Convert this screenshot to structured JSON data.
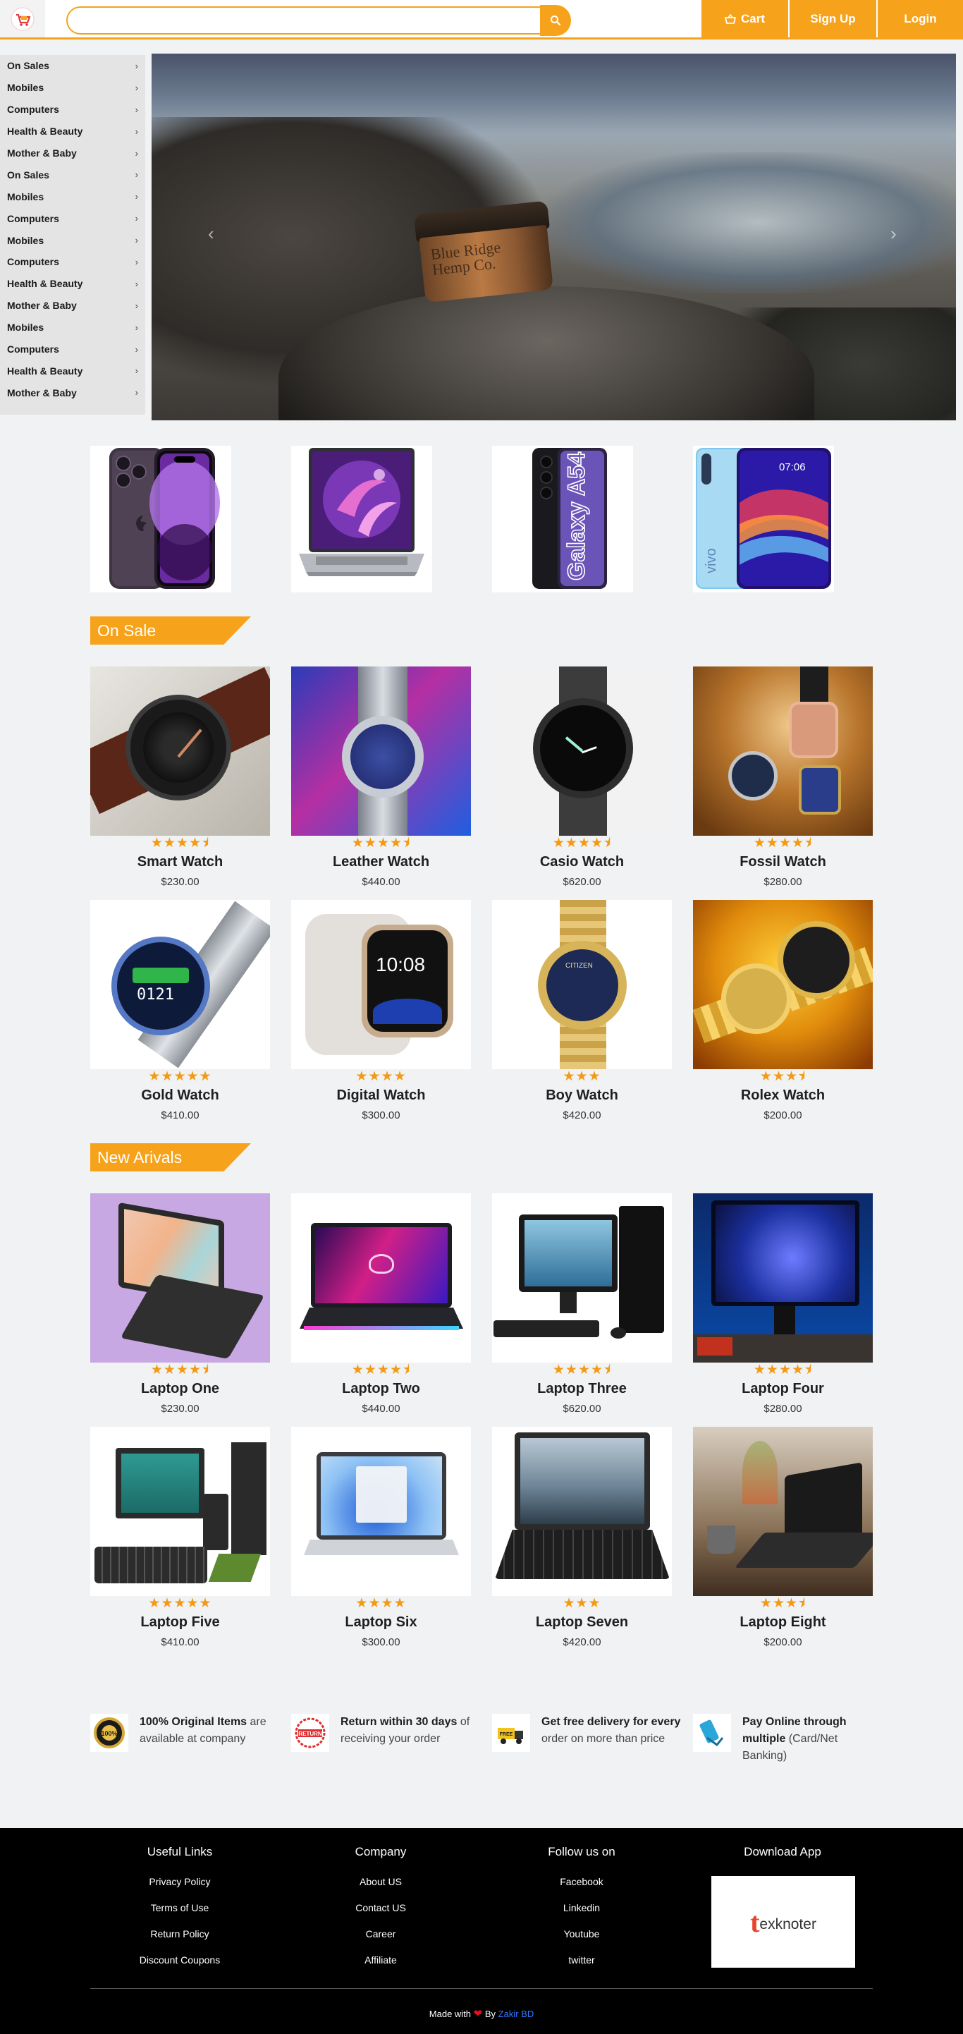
{
  "header": {
    "search": {
      "value": "",
      "placeholder": ""
    },
    "search_icon": "search-icon",
    "nav": {
      "cart": "Cart",
      "signup": "Sign Up",
      "login": "Login"
    },
    "accent_color": "#f7a21b"
  },
  "sidebar": {
    "items": [
      "On Sales",
      "Mobiles",
      "Computers",
      "Health & Beauty",
      "Mother & Baby",
      "On Sales",
      "Mobiles",
      "Computers",
      "Mobiles",
      "Computers",
      "Health & Beauty",
      "Mother & Baby",
      "Mobiles",
      "Computers",
      "Health & Beauty",
      "Mother & Baby"
    ],
    "chevron": "›"
  },
  "hero": {
    "jar_text": [
      "Blue Ridge",
      "Hemp Co."
    ],
    "prev_arrow": "‹",
    "next_arrow": "›"
  },
  "categories": [
    {
      "name": "iPhone",
      "kind": "phone-purple"
    },
    {
      "name": "Laptop",
      "kind": "laptop"
    },
    {
      "name": "Galaxy A54 5G",
      "kind": "phone-galaxy",
      "text": "Galaxy A54 5G"
    },
    {
      "name": "vivo",
      "kind": "phone-vivo",
      "text": "vivo",
      "time": "07:06"
    }
  ],
  "sections": {
    "on_sale": "On Sale",
    "new_arrivals": "New Arivals"
  },
  "on_sale_products": [
    {
      "name": "Smart Watch",
      "price": "$230.00",
      "stars": "★★★★⯨",
      "watch_text": ""
    },
    {
      "name": "Leather Watch",
      "price": "$440.00",
      "stars": "★★★★⯨",
      "watch_text": ""
    },
    {
      "name": "Casio Watch",
      "price": "$620.00",
      "stars": "★★★★⯨",
      "watch_text": ""
    },
    {
      "name": "Fossil Watch",
      "price": "$280.00",
      "stars": "★★★★⯨",
      "watch_text": ""
    },
    {
      "name": "Gold Watch",
      "price": "$410.00",
      "stars": "★★★★★",
      "watch_text": "0121"
    },
    {
      "name": "Digital Watch",
      "price": "$300.00",
      "stars": "★★★★",
      "watch_text": "10:08"
    },
    {
      "name": "Boy Watch",
      "price": "$420.00",
      "stars": "★★★",
      "watch_text": "CITIZEN"
    },
    {
      "name": "Rolex Watch",
      "price": "$200.00",
      "stars": "★★★⯨",
      "watch_text": ""
    }
  ],
  "new_arrival_products": [
    {
      "name": "Laptop One",
      "price": "$230.00",
      "stars": "★★★★⯨"
    },
    {
      "name": "Laptop Two",
      "price": "$440.00",
      "stars": "★★★★⯨"
    },
    {
      "name": "Laptop Three",
      "price": "$620.00",
      "stars": "★★★★⯨"
    },
    {
      "name": "Laptop Four",
      "price": "$280.00",
      "stars": "★★★★⯨"
    },
    {
      "name": "Laptop Five",
      "price": "$410.00",
      "stars": "★★★★★"
    },
    {
      "name": "Laptop Six",
      "price": "$300.00",
      "stars": "★★★★"
    },
    {
      "name": "Laptop Seven",
      "price": "$420.00",
      "stars": "★★★"
    },
    {
      "name": "Laptop Eight",
      "price": "$200.00",
      "stars": "★★★⯨"
    }
  ],
  "features": [
    {
      "icon": "original-badge-icon",
      "bold": "100% Original Items",
      "text": " are available at company"
    },
    {
      "icon": "return-stamp-icon",
      "bold": "Return within 30 days",
      "text": " of receiving your order"
    },
    {
      "icon": "free-delivery-icon",
      "bold": "Get free delivery for every",
      "text": " order on more than price"
    },
    {
      "icon": "online-payment-icon",
      "bold": "Pay Online through multiple",
      "text": " (Card/Net Banking)"
    }
  ],
  "footer": {
    "columns": [
      {
        "title": "Useful Links",
        "links": [
          "Privacy Policy",
          "Terms of Use",
          "Return Policy",
          "Discount Coupons"
        ]
      },
      {
        "title": "Company",
        "links": [
          "About US",
          "Contact US",
          "Career",
          "Affiliate"
        ]
      },
      {
        "title": "Follow us on",
        "links": [
          "Facebook",
          "Linkedin",
          "Youtube",
          "twitter"
        ]
      },
      {
        "title": "Download App",
        "links": []
      }
    ],
    "app_logo": {
      "first": "t",
      "rest": "exknoter"
    },
    "credit": {
      "made_with": "Made with",
      "heart": "❤",
      "by": "By",
      "author": "Zakir BD"
    }
  }
}
